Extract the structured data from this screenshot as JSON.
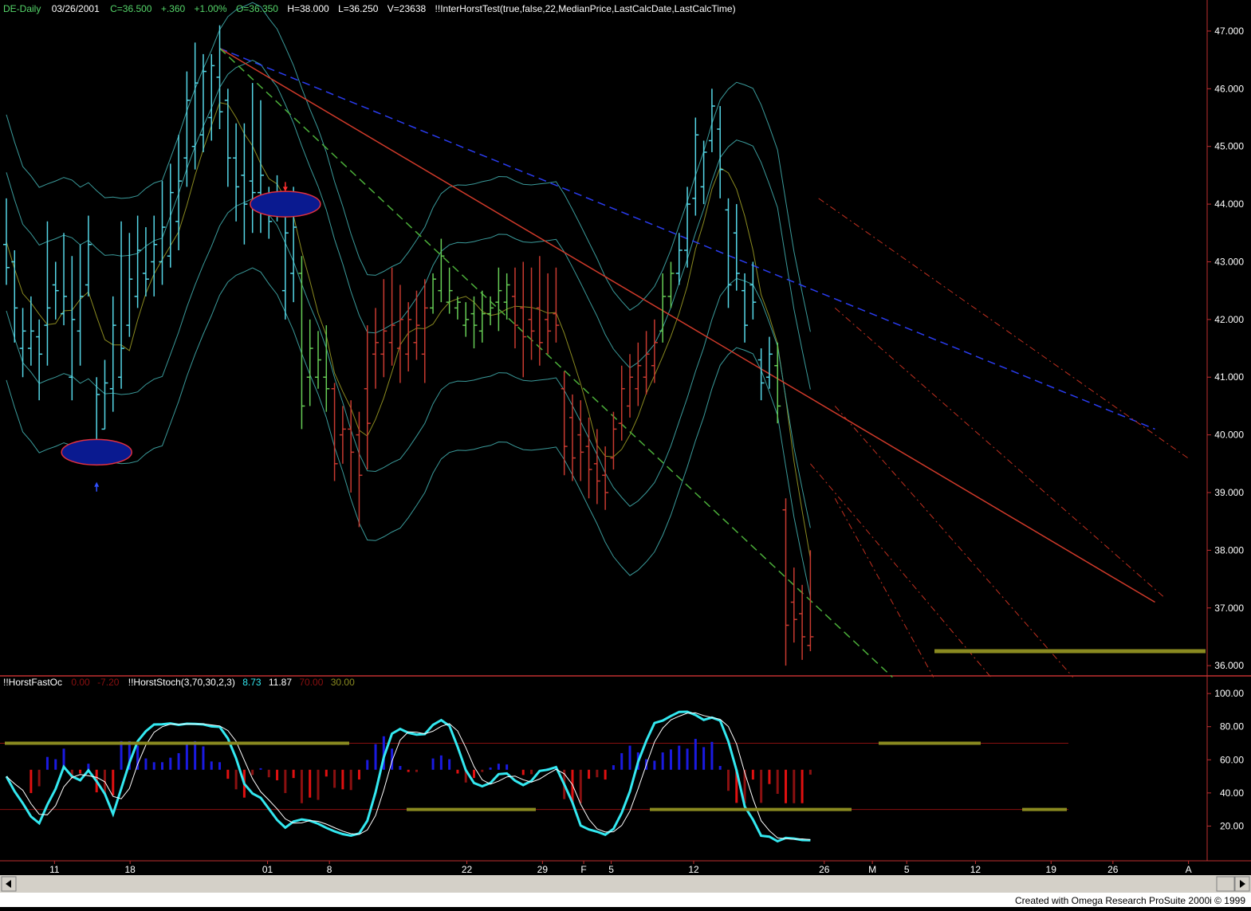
{
  "header": {
    "symbol": "DE-Daily",
    "date": "03/26/2001",
    "close": "C=36.500",
    "change": "+.360",
    "pct": "+1.00%",
    "open": "O=36.350",
    "high": "H=38.000",
    "low": "L=36.250",
    "volume": "V=23638",
    "study": "!!InterHorstTest(true,false,22,MedianPrice,LastCalcDate,LastCalcTime)"
  },
  "sub_header": {
    "fastosc_name": "!!HorstFastOc",
    "fastosc_v1": "0.00",
    "fastosc_v2": "-7.20",
    "stoch_name": "!!HorstStoch(3,70,30,2,3)",
    "stoch_v1": "8.73",
    "stoch_v2": "11.87",
    "stoch_v3": "70.00",
    "stoch_v4": "30.00"
  },
  "footer": {
    "credit": "Created with Omega Research ProSuite 2000i © 1999"
  },
  "colors": {
    "background": "#000000",
    "frame": "#c03030",
    "cyan": "#55d6e6",
    "bright_cyan": "#33e8f0",
    "green": "#66cc55",
    "red": "#c83a30",
    "blue_line": "#2a3cf0",
    "olive": "#8a8a20",
    "band": "#3a9a9a",
    "ellipse_fill": "#0a1a90",
    "osc_red": "#e01010",
    "osc_dark_red": "#8a1010",
    "osc_blue": "#1a1ae0"
  },
  "chart_data": [
    {
      "type": "ohlc",
      "title": "DE-Daily",
      "price_axis": {
        "ticks": [
          "47.000",
          "46.000",
          "45.000",
          "44.000",
          "43.000",
          "42.000",
          "41.000",
          "40.000",
          "39.000",
          "38.000",
          "37.000",
          "36.000"
        ],
        "ylim": [
          35.85,
          47.4
        ]
      },
      "date_axis": {
        "labels": [
          "11",
          "18",
          "01",
          "8",
          "22",
          "29",
          "F",
          "5",
          "12",
          "26",
          "M",
          "5",
          "12",
          "19",
          "26",
          "A"
        ]
      },
      "bars": [
        {
          "h": 44.1,
          "l": 42.6,
          "o": 43.3,
          "c": 42.9,
          "col": "cyan"
        },
        {
          "h": 43.2,
          "l": 41.6,
          "o": 43.0,
          "c": 42.2,
          "col": "cyan"
        },
        {
          "h": 42.2,
          "l": 41.0,
          "o": 41.5,
          "c": 41.8,
          "col": "cyan"
        },
        {
          "h": 42.4,
          "l": 41.2,
          "o": 41.5,
          "c": 41.8,
          "col": "cyan"
        },
        {
          "h": 42.0,
          "l": 40.6,
          "o": 41.7,
          "c": 41.4,
          "col": "cyan"
        },
        {
          "h": 43.7,
          "l": 41.2,
          "o": 41.9,
          "c": 42.2,
          "col": "cyan"
        },
        {
          "h": 43.0,
          "l": 42.0,
          "o": 42.6,
          "c": 42.5,
          "col": "cyan"
        },
        {
          "h": 43.5,
          "l": 41.9,
          "o": 42.1,
          "c": 42.4,
          "col": "cyan"
        },
        {
          "h": 43.1,
          "l": 40.6,
          "o": 41.0,
          "c": 42.0,
          "col": "cyan"
        },
        {
          "h": 43.3,
          "l": 41.2,
          "o": 41.8,
          "c": 42.4,
          "col": "cyan"
        },
        {
          "h": 43.8,
          "l": 42.4,
          "o": 42.6,
          "c": 43.3,
          "col": "cyan"
        },
        {
          "h": 41.0,
          "l": 39.7,
          "o": 39.8,
          "c": 40.7,
          "col": "cyan"
        },
        {
          "h": 41.3,
          "l": 40.1,
          "o": 40.1,
          "c": 40.9,
          "col": "cyan"
        },
        {
          "h": 42.4,
          "l": 40.4,
          "o": 40.8,
          "c": 41.9,
          "col": "cyan"
        },
        {
          "h": 43.7,
          "l": 40.8,
          "o": 41.0,
          "c": 41.5,
          "col": "cyan"
        },
        {
          "h": 43.5,
          "l": 41.7,
          "o": 41.9,
          "c": 42.7,
          "col": "cyan"
        },
        {
          "h": 43.8,
          "l": 42.2,
          "o": 42.4,
          "c": 43.2,
          "col": "cyan"
        },
        {
          "h": 43.6,
          "l": 42.4,
          "o": 42.8,
          "c": 42.7,
          "col": "cyan"
        },
        {
          "h": 43.8,
          "l": 42.4,
          "o": 43.0,
          "c": 43.3,
          "col": "cyan"
        },
        {
          "h": 44.4,
          "l": 42.6,
          "o": 43.0,
          "c": 43.6,
          "col": "cyan"
        },
        {
          "h": 44.7,
          "l": 42.9,
          "o": 43.1,
          "c": 44.2,
          "col": "cyan"
        },
        {
          "h": 45.2,
          "l": 43.2,
          "o": 43.7,
          "c": 44.4,
          "col": "cyan"
        },
        {
          "h": 46.3,
          "l": 44.3,
          "o": 44.8,
          "c": 45.8,
          "col": "cyan"
        },
        {
          "h": 46.8,
          "l": 44.6,
          "o": 45.0,
          "c": 46.1,
          "col": "cyan"
        },
        {
          "h": 46.6,
          "l": 44.9,
          "o": 45.2,
          "c": 46.3,
          "col": "cyan"
        },
        {
          "h": 46.6,
          "l": 45.1,
          "o": 45.5,
          "c": 46.4,
          "col": "cyan"
        },
        {
          "h": 47.1,
          "l": 45.3,
          "o": 46.2,
          "c": 45.6,
          "col": "cyan"
        },
        {
          "h": 46.0,
          "l": 44.3,
          "o": 45.8,
          "c": 44.8,
          "col": "cyan"
        },
        {
          "h": 45.4,
          "l": 43.7,
          "o": 44.8,
          "c": 44.3,
          "col": "cyan"
        },
        {
          "h": 45.4,
          "l": 43.3,
          "o": 44.5,
          "c": 44.0,
          "col": "cyan"
        },
        {
          "h": 46.1,
          "l": 43.5,
          "o": 44.4,
          "c": 44.2,
          "col": "cyan"
        },
        {
          "h": 45.8,
          "l": 43.5,
          "o": 44.2,
          "c": 44.5,
          "col": "cyan"
        },
        {
          "h": 44.3,
          "l": 43.4,
          "o": 43.9,
          "c": 43.7,
          "col": "cyan"
        },
        {
          "h": 44.5,
          "l": 43.7,
          "o": 44.0,
          "c": 44.2,
          "col": "cyan"
        },
        {
          "h": 44.2,
          "l": 42.0,
          "o": 42.5,
          "c": 43.5,
          "col": "cyan"
        },
        {
          "h": 44.3,
          "l": 42.3,
          "o": 42.8,
          "c": 43.6,
          "col": "cyan"
        },
        {
          "h": 43.1,
          "l": 40.1,
          "o": 42.8,
          "c": 40.5,
          "col": "green"
        },
        {
          "h": 42.0,
          "l": 40.5,
          "o": 41.0,
          "c": 41.5,
          "col": "green"
        },
        {
          "h": 41.8,
          "l": 40.8,
          "o": 41.0,
          "c": 41.3,
          "col": "green"
        },
        {
          "h": 41.9,
          "l": 40.4,
          "o": 41.0,
          "c": 40.8,
          "col": "green"
        },
        {
          "h": 40.9,
          "l": 39.2,
          "o": 40.8,
          "c": 39.5,
          "col": "red"
        },
        {
          "h": 40.5,
          "l": 39.5,
          "o": 40.0,
          "c": 40.1,
          "col": "red"
        },
        {
          "h": 40.6,
          "l": 39.0,
          "o": 40.1,
          "c": 39.7,
          "col": "red"
        },
        {
          "h": 40.4,
          "l": 38.4,
          "o": 40.0,
          "c": 39.3,
          "col": "red"
        },
        {
          "h": 41.9,
          "l": 39.4,
          "o": 40.8,
          "c": 40.2,
          "col": "red"
        },
        {
          "h": 42.2,
          "l": 40.8,
          "o": 41.4,
          "c": 41.6,
          "col": "red"
        },
        {
          "h": 42.7,
          "l": 41.0,
          "o": 41.4,
          "c": 41.8,
          "col": "red"
        },
        {
          "h": 42.9,
          "l": 41.2,
          "o": 41.6,
          "c": 41.9,
          "col": "red"
        },
        {
          "h": 42.6,
          "l": 40.9,
          "o": 41.5,
          "c": 42.0,
          "col": "red"
        },
        {
          "h": 42.3,
          "l": 41.1,
          "o": 41.4,
          "c": 42.0,
          "col": "red"
        },
        {
          "h": 42.5,
          "l": 41.3,
          "o": 41.6,
          "c": 41.9,
          "col": "red"
        },
        {
          "h": 42.7,
          "l": 40.9,
          "o": 41.4,
          "c": 42.2,
          "col": "red"
        },
        {
          "h": 42.8,
          "l": 42.1,
          "o": 42.2,
          "c": 42.7,
          "col": "green"
        },
        {
          "h": 43.4,
          "l": 42.3,
          "o": 42.5,
          "c": 43.1,
          "col": "green"
        },
        {
          "h": 42.9,
          "l": 42.1,
          "o": 42.3,
          "c": 42.5,
          "col": "green"
        },
        {
          "h": 42.4,
          "l": 42.0,
          "o": 42.2,
          "c": 42.3,
          "col": "green"
        },
        {
          "h": 42.3,
          "l": 41.7,
          "o": 41.9,
          "c": 42.0,
          "col": "green"
        },
        {
          "h": 42.4,
          "l": 41.5,
          "o": 42.1,
          "c": 41.9,
          "col": "green"
        },
        {
          "h": 42.5,
          "l": 41.6,
          "o": 41.8,
          "c": 42.1,
          "col": "green"
        },
        {
          "h": 42.4,
          "l": 41.9,
          "o": 42.1,
          "c": 42.2,
          "col": "green"
        },
        {
          "h": 42.9,
          "l": 41.8,
          "o": 42.3,
          "c": 42.5,
          "col": "green"
        },
        {
          "h": 42.8,
          "l": 42.0,
          "o": 42.3,
          "c": 42.6,
          "col": "green"
        },
        {
          "h": 42.9,
          "l": 41.5,
          "o": 42.4,
          "c": 41.9,
          "col": "red"
        },
        {
          "h": 43.0,
          "l": 41.0,
          "o": 42.2,
          "c": 41.7,
          "col": "red"
        },
        {
          "h": 42.9,
          "l": 41.3,
          "o": 42.0,
          "c": 41.8,
          "col": "red"
        },
        {
          "h": 43.1,
          "l": 41.2,
          "o": 42.2,
          "c": 41.6,
          "col": "red"
        },
        {
          "h": 42.8,
          "l": 41.4,
          "o": 42.0,
          "c": 41.8,
          "col": "red"
        },
        {
          "h": 42.9,
          "l": 41.6,
          "o": 42.1,
          "c": 41.9,
          "col": "red"
        },
        {
          "h": 41.1,
          "l": 39.3,
          "o": 40.8,
          "c": 39.8,
          "col": "red"
        },
        {
          "h": 40.7,
          "l": 39.2,
          "o": 40.3,
          "c": 39.6,
          "col": "red"
        },
        {
          "h": 40.6,
          "l": 39.2,
          "o": 40.0,
          "c": 39.7,
          "col": "red"
        },
        {
          "h": 40.3,
          "l": 38.9,
          "o": 39.8,
          "c": 39.4,
          "col": "red"
        },
        {
          "h": 40.1,
          "l": 38.8,
          "o": 39.5,
          "c": 39.2,
          "col": "red"
        },
        {
          "h": 39.8,
          "l": 38.7,
          "o": 39.3,
          "c": 39.0,
          "col": "red"
        },
        {
          "h": 40.4,
          "l": 39.4,
          "o": 39.6,
          "c": 40.1,
          "col": "red"
        },
        {
          "h": 41.2,
          "l": 39.9,
          "o": 40.2,
          "c": 40.8,
          "col": "red"
        },
        {
          "h": 41.4,
          "l": 40.3,
          "o": 40.5,
          "c": 41.0,
          "col": "red"
        },
        {
          "h": 41.6,
          "l": 40.5,
          "o": 40.8,
          "c": 41.2,
          "col": "red"
        },
        {
          "h": 41.8,
          "l": 40.7,
          "o": 41.0,
          "c": 41.4,
          "col": "red"
        },
        {
          "h": 42.0,
          "l": 40.9,
          "o": 41.2,
          "c": 41.6,
          "col": "red"
        },
        {
          "h": 42.8,
          "l": 41.6,
          "o": 41.8,
          "c": 42.4,
          "col": "green"
        },
        {
          "h": 43.0,
          "l": 42.2,
          "o": 42.4,
          "c": 42.8,
          "col": "green"
        },
        {
          "h": 43.5,
          "l": 42.6,
          "o": 42.8,
          "c": 43.2,
          "col": "cyan"
        },
        {
          "h": 44.3,
          "l": 42.9,
          "o": 43.2,
          "c": 44.0,
          "col": "cyan"
        },
        {
          "h": 45.5,
          "l": 43.8,
          "o": 44.1,
          "c": 45.2,
          "col": "cyan"
        },
        {
          "h": 45.1,
          "l": 44.0,
          "o": 44.3,
          "c": 44.9,
          "col": "cyan"
        },
        {
          "h": 46.0,
          "l": 44.9,
          "o": 45.1,
          "c": 45.7,
          "col": "cyan"
        },
        {
          "h": 45.7,
          "l": 44.1,
          "o": 45.3,
          "c": 44.6,
          "col": "cyan"
        },
        {
          "h": 44.1,
          "l": 42.2,
          "o": 43.9,
          "c": 42.6,
          "col": "cyan"
        },
        {
          "h": 44.0,
          "l": 42.5,
          "o": 43.5,
          "c": 42.8,
          "col": "cyan"
        },
        {
          "h": 42.8,
          "l": 41.6,
          "o": 42.5,
          "c": 41.9,
          "col": "cyan"
        },
        {
          "h": 43.0,
          "l": 42.0,
          "o": 42.6,
          "c": 42.3,
          "col": "cyan"
        },
        {
          "h": 41.5,
          "l": 40.6,
          "o": 41.3,
          "c": 40.9,
          "col": "cyan"
        },
        {
          "h": 41.7,
          "l": 40.8,
          "o": 41.0,
          "c": 41.4,
          "col": "cyan"
        },
        {
          "h": 41.6,
          "l": 40.2,
          "o": 41.2,
          "c": 40.5,
          "col": "green"
        },
        {
          "h": 38.9,
          "l": 36.0,
          "o": 38.7,
          "c": 36.7,
          "col": "red"
        },
        {
          "h": 37.7,
          "l": 36.4,
          "o": 37.1,
          "c": 36.8,
          "col": "red"
        },
        {
          "h": 37.4,
          "l": 36.1,
          "o": 36.9,
          "c": 36.5,
          "col": "red"
        },
        {
          "h": 38.0,
          "l": 36.25,
          "o": 36.35,
          "c": 36.5,
          "col": "red"
        }
      ],
      "ellipses": [
        {
          "bar": 11,
          "price": 39.7
        },
        {
          "bar": 34,
          "price": 44.0
        }
      ],
      "arrows": [
        {
          "bar": 11,
          "price": 39.1,
          "dir": "up",
          "color": "blue"
        },
        {
          "bar": 34,
          "price": 44.3,
          "dir": "down",
          "color": "red"
        }
      ],
      "lines": [
        {
          "name": "blue-trendline",
          "style": "dashed",
          "color": "blue",
          "points": [
            [
              26,
              46.7
            ],
            [
              140,
              40.1
            ]
          ]
        },
        {
          "name": "red-trendline",
          "style": "solid",
          "color": "red",
          "points": [
            [
              26,
              46.7
            ],
            [
              140,
              37.1
            ]
          ]
        },
        {
          "name": "green-trendline",
          "style": "dashed",
          "color": "green",
          "points": [
            [
              26,
              46.7
            ],
            [
              108,
              35.8
            ]
          ]
        }
      ]
    },
    {
      "type": "oscillator",
      "axis": {
        "ticks": [
          "100.00",
          "80.00",
          "60.00",
          "40.00",
          "20.00"
        ],
        "ylim": [
          0,
          102
        ]
      },
      "levels": [
        70,
        30
      ]
    }
  ]
}
